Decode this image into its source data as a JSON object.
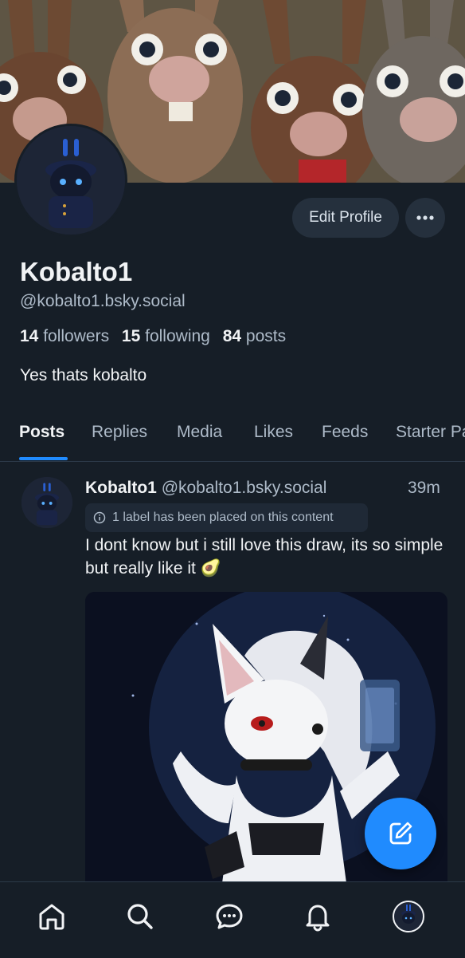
{
  "profile": {
    "display_name": "Kobalto1",
    "handle": "@kobalto1.bsky.social",
    "followers_count": "14",
    "followers_label": "followers",
    "following_count": "15",
    "following_label": "following",
    "posts_count": "84",
    "posts_label": "posts",
    "bio": "Yes thats kobalto",
    "edit_profile_label": "Edit Profile"
  },
  "tabs": [
    {
      "label": "Posts",
      "active": true
    },
    {
      "label": "Replies",
      "active": false
    },
    {
      "label": "Media",
      "active": false
    },
    {
      "label": "Likes",
      "active": false
    },
    {
      "label": "Feeds",
      "active": false
    },
    {
      "label": "Starter Packs",
      "active": false
    }
  ],
  "post": {
    "author_name": "Kobalto1",
    "author_handle": "@kobalto1.bsky.social",
    "time": "39m",
    "label_notice": "1 label has been placed on this content",
    "text": "I dont know but i still love this draw, its so simple but really like it 🥑"
  },
  "colors": {
    "background": "#161e27",
    "accent": "#208bfe",
    "muted_text": "#aebbc9"
  },
  "icons": [
    "more-icon",
    "info-icon",
    "compose-icon",
    "home-icon",
    "search-icon",
    "chat-icon",
    "bell-icon"
  ]
}
